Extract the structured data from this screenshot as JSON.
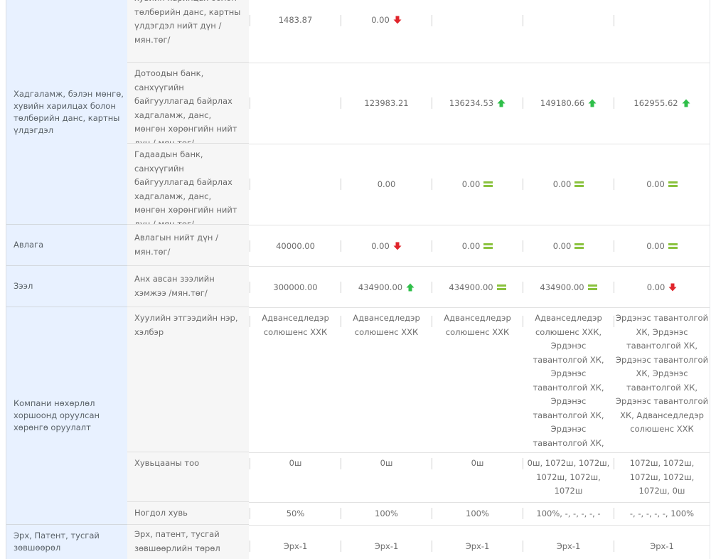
{
  "groups": {
    "deposits": "Хадгаламж, бэлэн мөнгө, хувийн харилцах болон төлбөрийн данс, картны үлдэгдэл",
    "receivables": "Авлага",
    "loans": "Зээл",
    "company": "Компани нөхөрлөл хоршоонд оруулсан хөрөнгө оруулалт",
    "rights": "Эрх, Патент, тусгай зөвшөөрөл"
  },
  "rows": {
    "r0": {
      "label": "хувийн харилцах болон төлбөрийн данс, картны үлдэгдэл нийт дүн / мян.төг/",
      "v1": "1483.87",
      "v2": "0.00"
    },
    "r1": {
      "label": "Дотоодын банк, санхүүгийн байгууллагад байрлах хадгаламж, данс, мөнгөн хөрөнгийн нийт дүн / мян.төг/",
      "v2": "123983.21",
      "v3": "136234.53",
      "v4": "149180.66",
      "v5": "162955.62"
    },
    "r2": {
      "label": "Гадаадын банк, санхүүгийн байгууллагад байрлах хадгаламж, данс, мөнгөн хөрөнгийн нийт дүн / мян.төг/",
      "v2": "0.00",
      "v3": "0.00",
      "v4": "0.00",
      "v5": "0.00"
    },
    "r3": {
      "label": "Авлагын нийт дүн / мян.төг/",
      "v1": "40000.00",
      "v2": "0.00",
      "v3": "0.00",
      "v4": "0.00",
      "v5": "0.00"
    },
    "r4": {
      "label": "Анх авсан зээлийн хэмжээ /мян.төг/",
      "v1": "300000.00",
      "v2": "434900.00",
      "v3": "434900.00",
      "v4": "434900.00",
      "v5": "0.00"
    },
    "r5": {
      "label": "Хуулийн этгээдийн нэр, хэлбэр",
      "v1": "Адванседледэр солюшенс ХХК",
      "v2": "Адванседледэр солюшенс ХХК",
      "v3": "Адванседледэр солюшенс ХХК",
      "v4": "Адванседледэр солюшенс ХХК, Эрдэнэс тавантолгой ХК, Эрдэнэс тавантолгой ХК, Эрдэнэс тавантолгой ХК, Эрдэнэс тавантолгой ХК, Эрдэнэс тавантолгой ХК",
      "v5": "Эрдэнэс тавантолгой ХК, Эрдэнэс тавантолгой ХК, Эрдэнэс тавантолгой ХК, Эрдэнэс тавантолгой ХК, Эрдэнэс тавантолгой ХК, Адванседледэр солюшенс ХХК"
    },
    "r6": {
      "label": "Хувьцааны тоо",
      "v1": "0ш",
      "v2": "0ш",
      "v3": "0ш",
      "v4": "0ш, 1072ш, 1072ш, 1072ш, 1072ш, 1072ш",
      "v5": "1072ш, 1072ш, 1072ш, 1072ш, 1072ш, 0ш"
    },
    "r7": {
      "label": "Ногдол хувь",
      "v1": "50%",
      "v2": "100%",
      "v3": "100%",
      "v4": "100%, -, -, -, -, -",
      "v5": "-, -, -, -, -, 100%"
    },
    "r8": {
      "label": "Эрх, патент, тусгай зөвшөөрлийн төрөл",
      "v1": "Эрх-1",
      "v2": "Эрх-1",
      "v3": "Эрх-1",
      "v4": "Эрх-1",
      "v5": "Эрх-1"
    }
  },
  "colors": {
    "up": "#2fbf4a",
    "down": "#e0242b",
    "flat": "#8ac23e",
    "group_bg": "#e8f1ff",
    "label_bg": "#f6f6f6"
  },
  "icons": {
    "up": "arrow-up-icon",
    "down": "arrow-down-icon",
    "flat": "equal-icon"
  }
}
